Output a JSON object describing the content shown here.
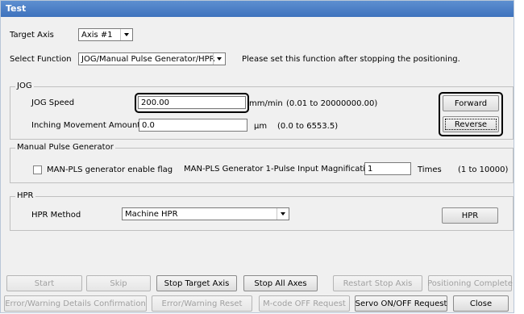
{
  "window": {
    "title": "Test"
  },
  "target_axis": {
    "label": "Target Axis",
    "value": "Axis #1"
  },
  "select_function": {
    "label": "Select Function",
    "value": "JOG/Manual Pulse Generator/HPR",
    "note": "Please set this function after stopping the positioning."
  },
  "jog": {
    "title": "JOG",
    "speed_label": "JOG Speed",
    "speed_value": "200.00",
    "speed_unit": "mm/min",
    "speed_range": "(0.01 to 20000000.00)",
    "inching_label": "Inching Movement Amount",
    "inching_value": "0.0",
    "inching_unit": "µm",
    "inching_range": "(0.0 to 6553.5)",
    "forward_label": "Forward",
    "reverse_label": "Reverse"
  },
  "manual_pulse": {
    "title": "Manual Pulse Generator",
    "enable_label": "MAN-PLS generator enable flag",
    "enable_checked": false,
    "magnification_label": "MAN-PLS Generator 1-Pulse Input Magnification",
    "magnification_value": "1",
    "times_label": "Times",
    "times_range": "(1 to 10000)"
  },
  "hpr": {
    "title": "HPR",
    "method_label": "HPR Method",
    "method_value": "Machine HPR",
    "button_label": "HPR"
  },
  "bottom_buttons": {
    "start": "Start",
    "skip": "Skip",
    "stop_target_axis": "Stop Target Axis",
    "stop_all_axes": "Stop All Axes",
    "restart_stop_axis": "Restart Stop Axis",
    "positioning_complete": "Positioning Complete",
    "error_details": "Error/Warning Details Confirmation",
    "error_reset": "Error/Warning Reset",
    "mcode_off": "M-code OFF Request",
    "servo_onoff": "Servo ON/OFF Request",
    "close": "Close"
  },
  "colors": {
    "titlebar": "#3e72bd",
    "dialog_bg": "#f0f0f0",
    "disabled_text": "#a0a0a0"
  }
}
